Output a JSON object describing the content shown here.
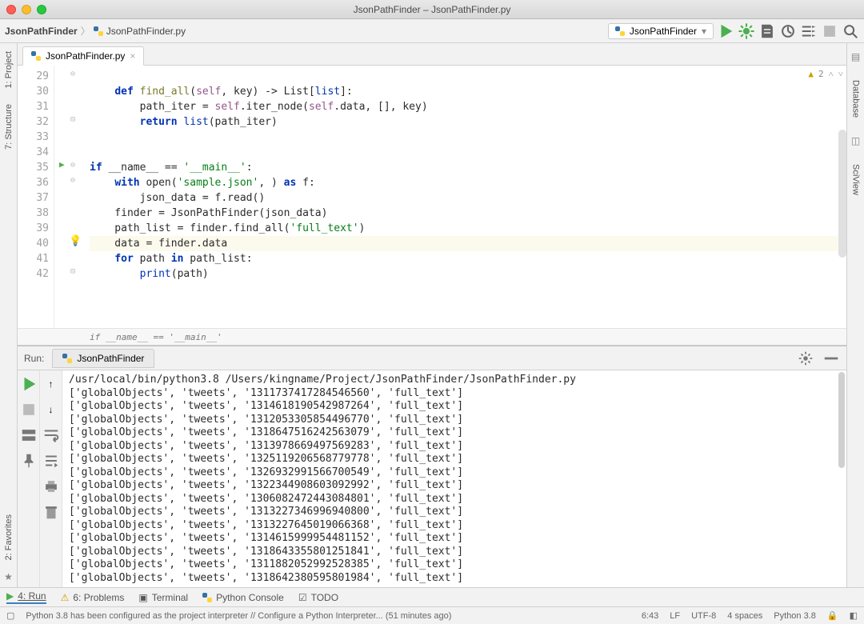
{
  "window": {
    "title": "JsonPathFinder – JsonPathFinder.py"
  },
  "breadcrumb": {
    "project": "JsonPathFinder",
    "file": "JsonPathFinder.py"
  },
  "run_config": {
    "name": "JsonPathFinder"
  },
  "editor": {
    "tab": "JsonPathFinder.py",
    "warn_count": "2",
    "context_crumb": "if __name__ == '__main__'",
    "line_numbers": [
      "29",
      "30",
      "31",
      "32",
      "33",
      "34",
      "35",
      "36",
      "37",
      "38",
      "39",
      "40",
      "41",
      "42"
    ],
    "highlight_line": "40"
  },
  "code": {
    "l29": "",
    "l30_def": "def ",
    "l30_fn": "find_all",
    "l30_mid": "(",
    "l30_self": "self",
    "l30_rest": ", key) -> List[",
    "l30_list": "list",
    "l30_end": "]:",
    "l31_a": "        path_iter = ",
    "l31_self": "self",
    "l31_b": ".iter_node(",
    "l31_self2": "self",
    "l31_c": ".data, [], key)",
    "l32_a": "        ",
    "l32_ret": "return ",
    "l32_list": "list",
    "l32_b": "(path_iter)",
    "l33": "",
    "l34": "",
    "l35_if": "if ",
    "l35_a": "__name__ == ",
    "l35_s": "'__main__'",
    "l35_b": ":",
    "l36_a": "    ",
    "l36_with": "with ",
    "l36_open": "open(",
    "l36_s": "'sample.json'",
    "l36_b": ", ) ",
    "l36_as": "as ",
    "l36_c": "f:",
    "l37": "        json_data = f.read()",
    "l38": "    finder = JsonPathFinder(json_data)",
    "l39_a": "    path_list = finder.find_all(",
    "l39_s": "'full_text'",
    "l39_b": ")",
    "l40": "    data = finder.data",
    "l41_a": "    ",
    "l41_for": "for ",
    "l41_b": "path ",
    "l41_in": "in ",
    "l41_c": "path_list:",
    "l42_a": "        ",
    "l42_print": "print",
    "l42_b": "(path)"
  },
  "run": {
    "label": "Run:",
    "tab": "JsonPathFinder",
    "cmd": "/usr/local/bin/python3.8 /Users/kingname/Project/JsonPathFinder/JsonPathFinder.py",
    "rows": [
      "['globalObjects', 'tweets', '1311737417284546560', 'full_text']",
      "['globalObjects', 'tweets', '1314618190542987264', 'full_text']",
      "['globalObjects', 'tweets', '1312053305854496770', 'full_text']",
      "['globalObjects', 'tweets', '1318647516242563079', 'full_text']",
      "['globalObjects', 'tweets', '1313978669497569283', 'full_text']",
      "['globalObjects', 'tweets', '1325119206568779778', 'full_text']",
      "['globalObjects', 'tweets', '1326932991566700549', 'full_text']",
      "['globalObjects', 'tweets', '1322344908603092992', 'full_text']",
      "['globalObjects', 'tweets', '1306082472443084801', 'full_text']",
      "['globalObjects', 'tweets', '1313227346996940800', 'full_text']",
      "['globalObjects', 'tweets', '1313227645019066368', 'full_text']",
      "['globalObjects', 'tweets', '1314615999954481152', 'full_text']",
      "['globalObjects', 'tweets', '1318643355801251841', 'full_text']",
      "['globalObjects', 'tweets', '1311882052992528385', 'full_text']",
      "['globalObjects', 'tweets', '1318642380595801984', 'full_text']"
    ]
  },
  "bottom_tabs": {
    "run": "4: Run",
    "problems": "6: Problems",
    "terminal": "Terminal",
    "pyconsole": "Python Console",
    "todo": "TODO"
  },
  "left_tabs": {
    "project": "1: Project",
    "structure": "7: Structure"
  },
  "lfav": {
    "fav": "2: Favorites"
  },
  "right_tabs": {
    "database": "Database",
    "sciview": "SciView"
  },
  "status": {
    "msg": "Python 3.8 has been configured as the project interpreter // Configure a Python Interpreter... (51 minutes ago)",
    "pos": "6:43",
    "lf": "LF",
    "enc": "UTF-8",
    "indent": "4 spaces",
    "py": "Python 3.8"
  }
}
